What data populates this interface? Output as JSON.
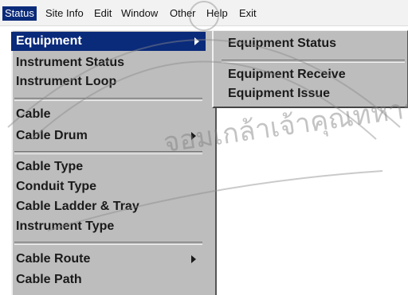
{
  "menubar": {
    "items": [
      "Status",
      "Site Info",
      "Edit",
      "Window",
      "Other",
      "Help",
      "Exit"
    ]
  },
  "status_menu": {
    "items": [
      {
        "label": "Equipment",
        "submenu": true
      },
      {
        "label": "Instrument Status"
      },
      {
        "label": "Instrument Loop"
      },
      {
        "label": "Cable"
      },
      {
        "label": "Cable Drum",
        "submenu": true
      },
      {
        "label": "Cable Type"
      },
      {
        "label": "Conduit Type"
      },
      {
        "label": "Cable Ladder & Tray"
      },
      {
        "label": "Instrument Type"
      },
      {
        "label": "Cable Route",
        "submenu": true
      },
      {
        "label": "Cable Path"
      }
    ]
  },
  "equipment_submenu": {
    "items": [
      "Equipment Status",
      "Equipment Receive",
      "Equipment Issue"
    ]
  },
  "watermark_text": "จอมเกล้าเจ้าคุณทหาร"
}
